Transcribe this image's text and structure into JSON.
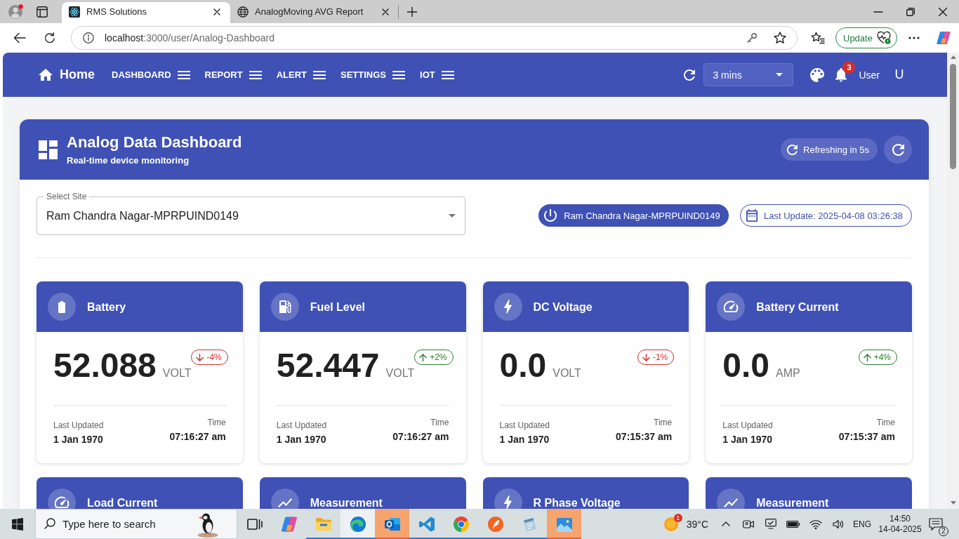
{
  "browser": {
    "tabs": [
      {
        "title": "RMS Solutions",
        "selected": true
      },
      {
        "title": "AnalogMoving AVG Report",
        "selected": false
      }
    ],
    "url": {
      "host": "localhost",
      "path": ":3000/user/Analog-Dashboard"
    },
    "update_button": "Update"
  },
  "navbar": {
    "home": "Home",
    "menus": [
      {
        "label": "DASHBOARD"
      },
      {
        "label": "REPORT"
      },
      {
        "label": "ALERT"
      },
      {
        "label": "SETTINGS"
      },
      {
        "label": "IOT"
      }
    ],
    "refresh_interval": "3 mins",
    "notification_count": "3",
    "user": "User",
    "avatar": "U"
  },
  "dashboard": {
    "title": "Analog Data Dashboard",
    "subtitle": "Real-time device monitoring",
    "refresh_status": "Refreshing in 5s",
    "site_select": {
      "label": "Select Site",
      "value": "Ram Chandra Nagar-MPRPUIND0149"
    },
    "site_chip": "Ram Chandra Nagar-MPRPUIND0149",
    "last_update": "Last Update: 2025-04-08 03:26:38",
    "cards": [
      {
        "title": "Battery",
        "value": "52.088",
        "unit": "VOLT",
        "change": "-4%",
        "rising": false,
        "updated_label": "Last Updated",
        "date": "1 Jan 1970",
        "time_label": "Time",
        "time": "07:16:27 am"
      },
      {
        "title": "Fuel Level",
        "value": "52.447",
        "unit": "VOLT",
        "change": "+2%",
        "rising": true,
        "updated_label": "Last Updated",
        "date": "1 Jan 1970",
        "time_label": "Time",
        "time": "07:16:27 am"
      },
      {
        "title": "DC Voltage",
        "value": "0.0",
        "unit": "VOLT",
        "change": "-1%",
        "rising": false,
        "updated_label": "Last Updated",
        "date": "1 Jan 1970",
        "time_label": "Time",
        "time": "07:15:37 am"
      },
      {
        "title": "Battery Current",
        "value": "0.0",
        "unit": "AMP",
        "change": "+4%",
        "rising": true,
        "updated_label": "Last Updated",
        "date": "1 Jan 1970",
        "time_label": "Time",
        "time": "07:15:37 am"
      }
    ],
    "next_row_cards": [
      {
        "title": "Load Current"
      },
      {
        "title": "Measurement"
      },
      {
        "title": "R Phase Voltage"
      },
      {
        "title": "Measurement"
      }
    ]
  },
  "taskbar": {
    "search_placeholder": "Type here to search",
    "apps": [
      {
        "running": false,
        "active": false,
        "flashing": false
      },
      {
        "running": false,
        "active": false,
        "flashing": false
      },
      {
        "running": true,
        "active": false,
        "flashing": false
      },
      {
        "running": true,
        "active": true,
        "flashing": false
      },
      {
        "running": true,
        "active": false,
        "flashing": true
      },
      {
        "running": true,
        "active": false,
        "flashing": false
      },
      {
        "running": true,
        "active": false,
        "flashing": false
      },
      {
        "running": true,
        "active": false,
        "flashing": false
      },
      {
        "running": true,
        "active": false,
        "flashing": false
      },
      {
        "running": true,
        "active": false,
        "flashing": true
      }
    ],
    "weather": {
      "badge": "1",
      "temperature": "39°C"
    },
    "language": "ENG",
    "time": "14:50",
    "date": "14-04-2025",
    "notification_count": "2"
  }
}
